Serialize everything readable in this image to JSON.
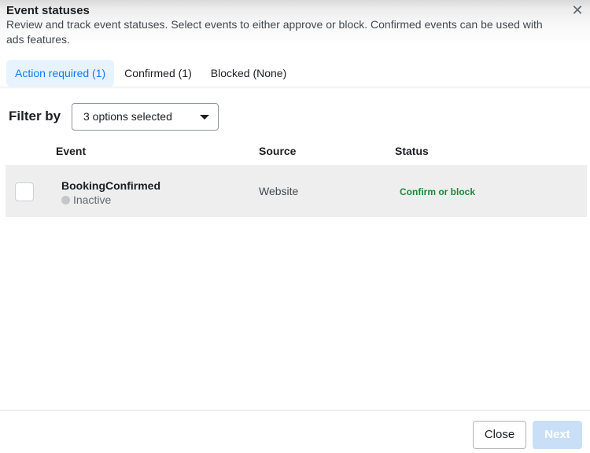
{
  "dialog": {
    "title": "Event statuses",
    "description": "Review and track event statuses. Select events to either approve or block. Confirmed events can be used with ads features.",
    "close_glyph": "✕"
  },
  "tabs": [
    {
      "label": "Action required (1)",
      "active": true
    },
    {
      "label": "Confirmed (1)",
      "active": false
    },
    {
      "label": "Blocked (None)",
      "active": false
    }
  ],
  "filter": {
    "label": "Filter by",
    "selected": "3 options selected"
  },
  "table": {
    "headers": {
      "event": "Event",
      "source": "Source",
      "status": "Status"
    },
    "rows": [
      {
        "event": "BookingConfirmed",
        "state": "Inactive",
        "source": "Website",
        "status": "Confirm or block",
        "checked": false
      }
    ]
  },
  "footer": {
    "close_label": "Close",
    "next_label": "Next"
  },
  "colors": {
    "accent": "#1877f2",
    "status_action": "#1a8a3a",
    "next_disabled": "#c9dff7"
  }
}
